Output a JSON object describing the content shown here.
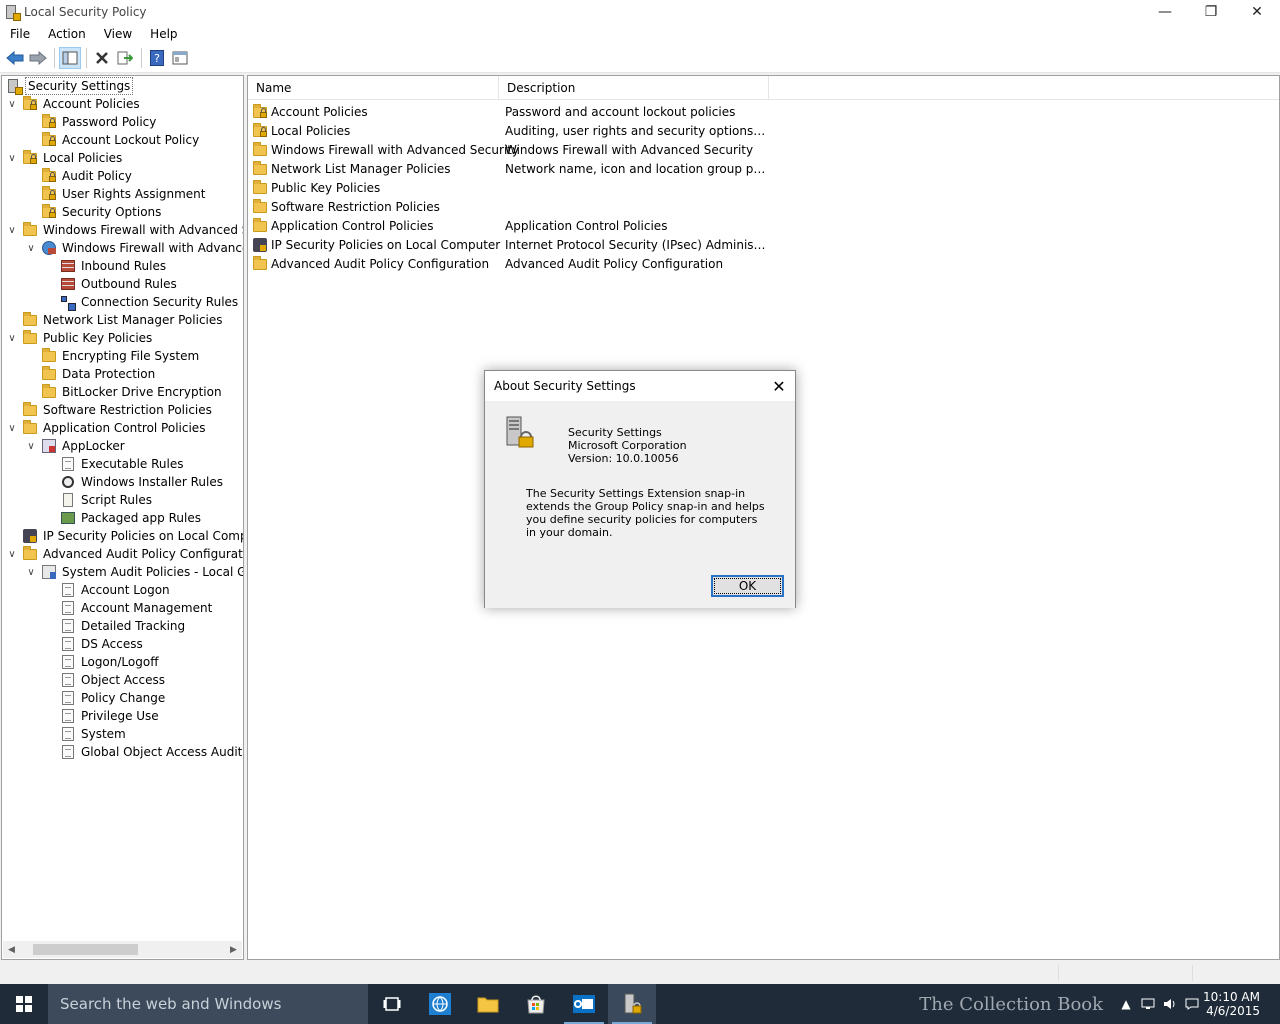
{
  "window": {
    "title": "Local Security Policy",
    "minimize": "—",
    "maximize": "❐",
    "close": "✕"
  },
  "menu": [
    "File",
    "Action",
    "View",
    "Help"
  ],
  "toolbar": {
    "buttons": [
      "back-icon",
      "forward-icon",
      "show-hide-tree-icon",
      "delete-icon",
      "export-list-icon",
      "help-icon",
      "properties-icon"
    ]
  },
  "tree": [
    {
      "label": "Security Settings",
      "level": 0,
      "icon": "security-settings-icon",
      "twisty": "",
      "selected": true
    },
    {
      "label": "Account Policies",
      "level": 1,
      "icon": "locked-folder-icon",
      "twisty": "∨"
    },
    {
      "label": "Password Policy",
      "level": 2,
      "icon": "locked-folder-icon",
      "twisty": ""
    },
    {
      "label": "Account Lockout Policy",
      "level": 2,
      "icon": "locked-folder-icon",
      "twisty": ""
    },
    {
      "label": "Local Policies",
      "level": 1,
      "icon": "locked-folder-icon",
      "twisty": "∨"
    },
    {
      "label": "Audit Policy",
      "level": 2,
      "icon": "locked-folder-icon",
      "twisty": ""
    },
    {
      "label": "User Rights Assignment",
      "level": 2,
      "icon": "locked-folder-icon",
      "twisty": ""
    },
    {
      "label": "Security Options",
      "level": 2,
      "icon": "locked-folder-icon",
      "twisty": ""
    },
    {
      "label": "Windows Firewall with Advanced Secu",
      "level": 1,
      "icon": "folder-icon",
      "twisty": "∨"
    },
    {
      "label": "Windows Firewall with Advanced",
      "level": 2,
      "icon": "firewall-globe-icon",
      "twisty": "∨"
    },
    {
      "label": "Inbound Rules",
      "level": 3,
      "icon": "firewall-icon",
      "twisty": ""
    },
    {
      "label": "Outbound Rules",
      "level": 3,
      "icon": "firewall-icon",
      "twisty": ""
    },
    {
      "label": "Connection Security Rules",
      "level": 3,
      "icon": "network-icon",
      "twisty": ""
    },
    {
      "label": "Network List Manager Policies",
      "level": 1,
      "icon": "folder-icon",
      "twisty": ""
    },
    {
      "label": "Public Key Policies",
      "level": 1,
      "icon": "folder-icon",
      "twisty": "∨"
    },
    {
      "label": "Encrypting File System",
      "level": 2,
      "icon": "folder-icon",
      "twisty": ""
    },
    {
      "label": "Data Protection",
      "level": 2,
      "icon": "folder-icon",
      "twisty": ""
    },
    {
      "label": "BitLocker Drive Encryption",
      "level": 2,
      "icon": "folder-icon",
      "twisty": ""
    },
    {
      "label": "Software Restriction Policies",
      "level": 1,
      "icon": "folder-icon",
      "twisty": ""
    },
    {
      "label": "Application Control Policies",
      "level": 1,
      "icon": "folder-icon",
      "twisty": "∨"
    },
    {
      "label": "AppLocker",
      "level": 2,
      "icon": "applocker-icon",
      "twisty": "∨"
    },
    {
      "label": "Executable Rules",
      "level": 3,
      "icon": "document-icon",
      "twisty": ""
    },
    {
      "label": "Windows Installer Rules",
      "level": 3,
      "icon": "installer-icon",
      "twisty": ""
    },
    {
      "label": "Script Rules",
      "level": 3,
      "icon": "script-icon",
      "twisty": ""
    },
    {
      "label": "Packaged app Rules",
      "level": 3,
      "icon": "packaged-app-icon",
      "twisty": ""
    },
    {
      "label": "IP Security Policies on Local Compute",
      "level": 1,
      "icon": "ipsec-icon",
      "twisty": ""
    },
    {
      "label": "Advanced Audit Policy Configuration",
      "level": 1,
      "icon": "folder-icon",
      "twisty": "∨"
    },
    {
      "label": "System Audit Policies - Local Grou",
      "level": 2,
      "icon": "audit-icon",
      "twisty": "∨"
    },
    {
      "label": "Account Logon",
      "level": 3,
      "icon": "audit-policy-icon",
      "twisty": ""
    },
    {
      "label": "Account Management",
      "level": 3,
      "icon": "audit-policy-icon",
      "twisty": ""
    },
    {
      "label": "Detailed Tracking",
      "level": 3,
      "icon": "audit-policy-icon",
      "twisty": ""
    },
    {
      "label": "DS Access",
      "level": 3,
      "icon": "audit-policy-icon",
      "twisty": ""
    },
    {
      "label": "Logon/Logoff",
      "level": 3,
      "icon": "audit-policy-icon",
      "twisty": ""
    },
    {
      "label": "Object Access",
      "level": 3,
      "icon": "audit-policy-icon",
      "twisty": ""
    },
    {
      "label": "Policy Change",
      "level": 3,
      "icon": "audit-policy-icon",
      "twisty": ""
    },
    {
      "label": "Privilege Use",
      "level": 3,
      "icon": "audit-policy-icon",
      "twisty": ""
    },
    {
      "label": "System",
      "level": 3,
      "icon": "audit-policy-icon",
      "twisty": ""
    },
    {
      "label": "Global Object Access Auditing",
      "level": 3,
      "icon": "audit-policy-icon",
      "twisty": ""
    }
  ],
  "list": {
    "columns": [
      "Name",
      "Description"
    ],
    "rows": [
      {
        "name": "Account Policies",
        "desc": "Password and account lockout policies",
        "icon": "locked-folder-icon"
      },
      {
        "name": "Local Policies",
        "desc": "Auditing, user rights and security options polici...",
        "icon": "locked-folder-icon"
      },
      {
        "name": "Windows Firewall with Advanced Security",
        "desc": "Windows Firewall with Advanced Security",
        "icon": "folder-icon"
      },
      {
        "name": "Network List Manager Policies",
        "desc": "Network name, icon and location group policies.",
        "icon": "folder-icon"
      },
      {
        "name": "Public Key Policies",
        "desc": "",
        "icon": "folder-icon"
      },
      {
        "name": "Software Restriction Policies",
        "desc": "",
        "icon": "folder-icon"
      },
      {
        "name": "Application Control Policies",
        "desc": "Application Control Policies",
        "icon": "folder-icon"
      },
      {
        "name": "IP Security Policies on Local Computer",
        "desc": "Internet Protocol Security (IPsec) Administratio...",
        "icon": "ipsec-icon"
      },
      {
        "name": "Advanced Audit Policy Configuration",
        "desc": "Advanced Audit Policy Configuration",
        "icon": "folder-icon"
      }
    ]
  },
  "dialog": {
    "title": "About Security Settings",
    "close": "✕",
    "product": "Security Settings",
    "company": "Microsoft Corporation",
    "version": "Version: 10.0.10056",
    "description": "The Security Settings Extension snap-in extends the Group Policy snap-in and helps you define security policies for computers in your domain.",
    "ok": "OK"
  },
  "taskbar": {
    "search_placeholder": "Search the web and Windows",
    "apps": [
      "task-view-icon",
      "internet-explorer-icon",
      "file-explorer-icon",
      "store-icon",
      "outlook-icon",
      "security-policy-app-icon"
    ],
    "watermark": "The Collection Book",
    "time": "10:10 AM",
    "date": "4/6/2015"
  },
  "colors": {
    "taskbar": "#1f2b38",
    "search_box": "#3c4a5b",
    "accent": "#2a73c6",
    "folder": "#f0c44f"
  }
}
